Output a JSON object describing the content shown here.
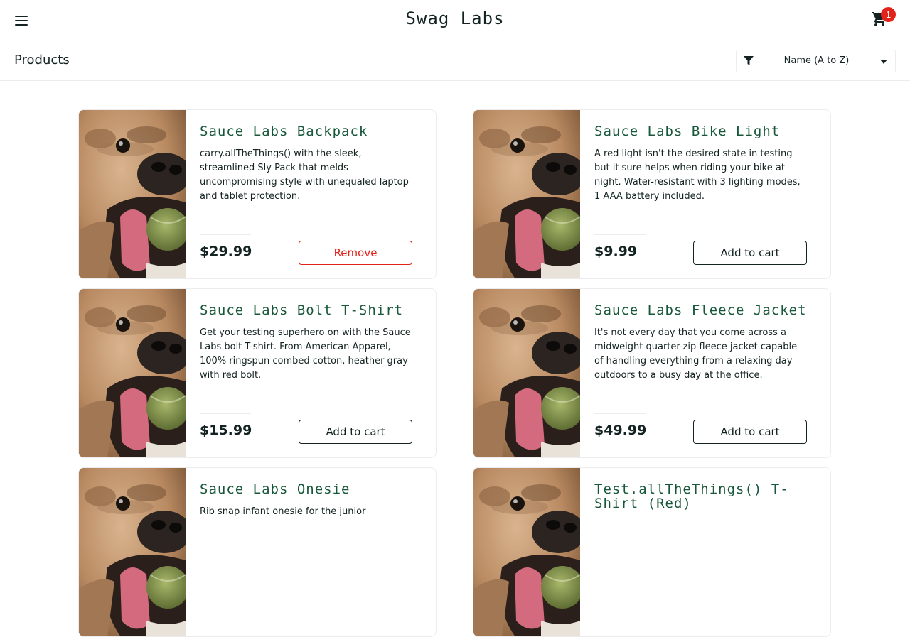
{
  "header": {
    "title": "Swag Labs",
    "cart_count": "1"
  },
  "subheader": {
    "title": "Products",
    "sort_selected": "Name (A to Z)"
  },
  "products": [
    {
      "name": "Sauce Labs Backpack",
      "description": "carry.allTheThings() with the sleek, streamlined Sly Pack that melds uncompromising style with unequaled laptop and tablet protection.",
      "price": "$29.99",
      "button": "Remove"
    },
    {
      "name": "Sauce Labs Bike Light",
      "description": "A red light isn't the desired state in testing but it sure helps when riding your bike at night. Water-resistant with 3 lighting modes, 1 AAA battery included.",
      "price": "$9.99",
      "button": "Add to cart"
    },
    {
      "name": "Sauce Labs Bolt T-Shirt",
      "description": "Get your testing superhero on with the Sauce Labs bolt T-shirt. From American Apparel, 100% ringspun combed cotton, heather gray with red bolt.",
      "price": "$15.99",
      "button": "Add to cart"
    },
    {
      "name": "Sauce Labs Fleece Jacket",
      "description": "It's not every day that you come across a midweight quarter-zip fleece jacket capable of handling everything from a relaxing day outdoors to a busy day at the office.",
      "price": "$49.99",
      "button": "Add to cart"
    },
    {
      "name": "Sauce Labs Onesie",
      "description": "Rib snap infant onesie for the junior",
      "price": "",
      "button": ""
    },
    {
      "name": "Test.allTheThings() T-Shirt (Red)",
      "description": "",
      "price": "",
      "button": ""
    }
  ],
  "colors": {
    "accent_green": "#18583a",
    "remove_red": "#e2231a",
    "badge_red": "#e2231a",
    "text_dark": "#132322"
  },
  "icons": {
    "menu": "hamburger-menu-icon",
    "cart": "shopping-cart-icon",
    "filter": "filter-icon",
    "sort_caret": "caret-down-icon"
  }
}
